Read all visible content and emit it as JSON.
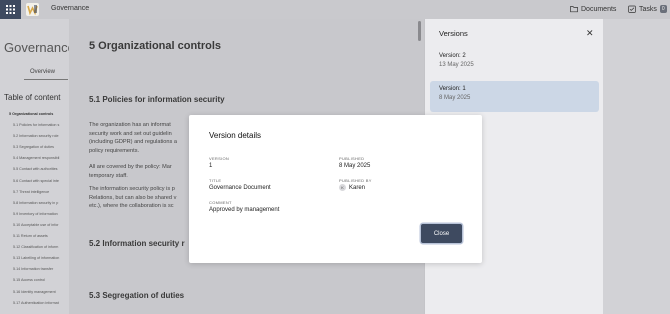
{
  "topbar": {
    "app_title": "Governance",
    "documents_label": "Documents",
    "tasks_label": "Tasks",
    "tasks_count": "0"
  },
  "background": {
    "page_title": "Governance",
    "tab_overview": "Overview",
    "toc_title": "Table of content",
    "toc_items": [
      "5 Organizational controls",
      "5.1 Policies for information s",
      "5.2 Information security role",
      "5.3 Segregation of duties",
      "5.4 Management responsibil",
      "5.5 Contact with authorities",
      "5.6 Contact with special inte",
      "5.7 Threat intelligence",
      "5.8 Information security in p",
      "5.9 Inventory of information",
      "5.10 Acceptable use of infor",
      "5.11 Return of assets",
      "5.12 Classification of inform",
      "5.13 Labelling of information",
      "5.14 Information transfer",
      "5.15 Access control",
      "5.16 Identity management",
      "5.17 Authentication informat"
    ]
  },
  "document": {
    "heading": "5 Organizational controls",
    "sec1_title": "5.1 Policies for information security",
    "para1_l1": "The organization has an informat",
    "para1_l2": "security work and set out guidelin",
    "para1_l3": "(including GDPR) and regulations a",
    "para1_l4": "policy requirements.",
    "para2_l1": "All are covered by the policy: Mar",
    "para2_l2": "temporary staff.",
    "para3_l1": "The information security policy is p",
    "para3_l2": "Relations, but can also be shared v",
    "para3_l3": "etc.), where the collaboration is sc",
    "sec2_title": "5.2 Information security r",
    "sec3_title": "5.3 Segregation of duties"
  },
  "versions": {
    "title": "Versions",
    "items": [
      {
        "name": "Version: 2",
        "date": "13 May 2025"
      },
      {
        "name": "Version: 1",
        "date": "8 May 2025"
      }
    ]
  },
  "modal": {
    "title": "Version details",
    "version_label": "VERSION",
    "version_value": "1",
    "published_label": "PUBLISHED",
    "published_value": "8 May 2025",
    "title_label": "TITLE",
    "title_value": "Governance Document",
    "published_by_label": "PUBLISHED BY",
    "published_by_initial": "K",
    "published_by_value": "Karen",
    "comment_label": "COMMENT",
    "comment_value": "Approved by management",
    "close_label": "Close"
  }
}
